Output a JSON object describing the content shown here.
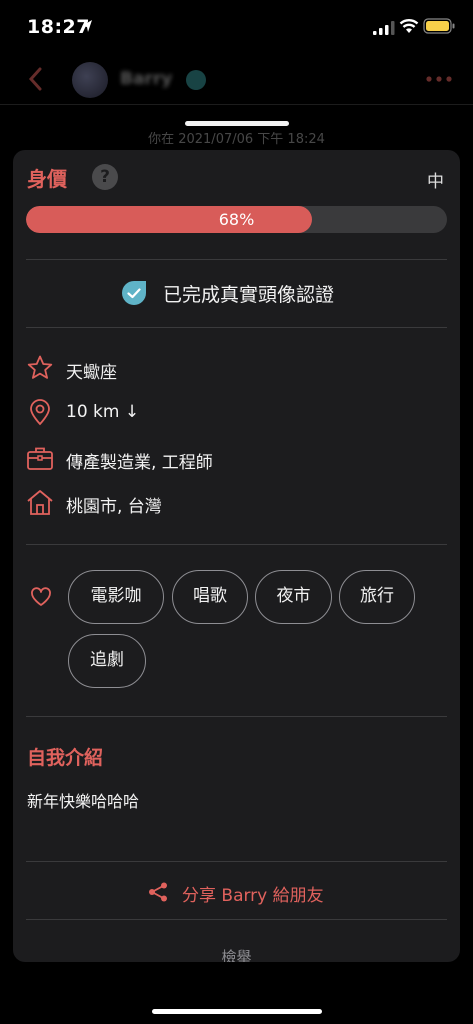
{
  "status_bar": {
    "time": "18:27"
  },
  "chat": {
    "name": "Barry",
    "date_stamp": "你在 2021/07/06 下午 18:24"
  },
  "profile": {
    "value_title": "身價",
    "help_symbol": "?",
    "level": "中",
    "progress": {
      "percent": 68,
      "label": "68%"
    },
    "verification": "已完成真實頭像認證",
    "info": {
      "zodiac": "天蠍座",
      "distance": "10 km ↓",
      "job": "傳產製造業, 工程師",
      "location": "桃園市, 台灣"
    },
    "interests": [
      "電影咖",
      "唱歌",
      "夜市",
      "旅行",
      "追劇"
    ],
    "intro_title": "自我介紹",
    "intro_text": "新年快樂哈哈哈",
    "share_label": "分享 Barry 給朋友",
    "report_label": "檢舉"
  },
  "colors": {
    "accent": "#e0625d",
    "progress_fill": "#d85c59",
    "verified": "#5fb3c7",
    "card_bg": "#1c1c1e"
  },
  "icons": {
    "star": "star-icon",
    "location": "location-pin-icon",
    "job": "briefcase-icon",
    "home": "home-icon",
    "heart": "heart-icon",
    "share": "share-icon",
    "verify": "verified-badge-icon"
  }
}
